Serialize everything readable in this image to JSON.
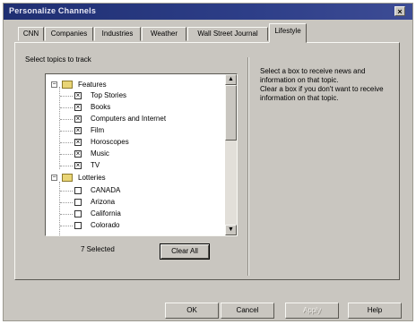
{
  "window": {
    "title": "Personalize Channels",
    "close_glyph": "×"
  },
  "tabs": [
    "CNN",
    "Companies",
    "Industries",
    "Weather",
    "Wall Street Journal",
    "Lifestyle"
  ],
  "active_tab": "Lifestyle",
  "topics": {
    "group_label": "Select topics to track",
    "items": [
      {
        "label": "Features",
        "type": "folder",
        "expanded": true
      },
      {
        "label": "Top Stories",
        "checked": true
      },
      {
        "label": "Books",
        "checked": true
      },
      {
        "label": "Computers and Internet",
        "checked": true
      },
      {
        "label": "Film",
        "checked": true
      },
      {
        "label": "Horoscopes",
        "checked": true
      },
      {
        "label": "Music",
        "checked": true
      },
      {
        "label": "TV",
        "checked": true
      },
      {
        "label": "Lotteries",
        "type": "folder",
        "expanded": true
      },
      {
        "label": "CANADA",
        "checked": false
      },
      {
        "label": "Arizona",
        "checked": false
      },
      {
        "label": "California",
        "checked": false
      },
      {
        "label": "Colorado",
        "checked": false
      }
    ],
    "selected_count": "7 Selected",
    "clear_button": "Clear All"
  },
  "info": {
    "line1": "Select a box to receive news and information on that topic.",
    "line2": "Clear a box if you don't want to receive information on that topic."
  },
  "buttons": {
    "ok": "OK",
    "cancel": "Cancel",
    "apply": "Apply",
    "help": "Help"
  }
}
